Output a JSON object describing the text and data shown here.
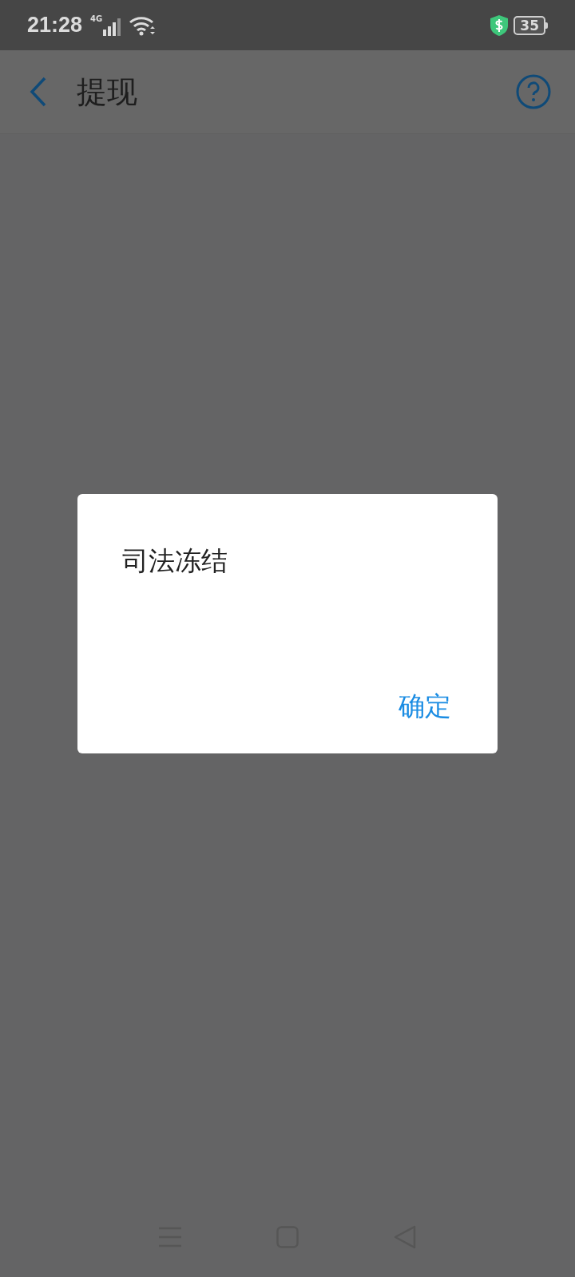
{
  "status_bar": {
    "time": "21:28",
    "network": "4G",
    "battery": "35"
  },
  "app_bar": {
    "title": "提现"
  },
  "dialog": {
    "message": "司法冻结",
    "buttons": [
      "确定"
    ]
  }
}
